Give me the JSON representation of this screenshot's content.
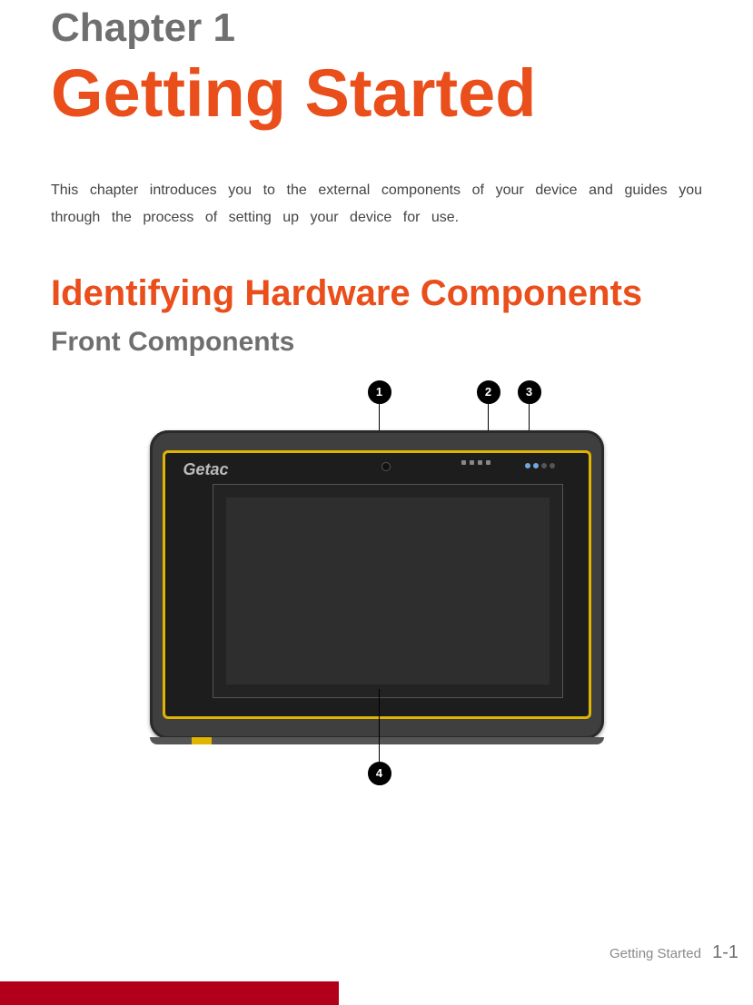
{
  "chapter_label": "Chapter 1",
  "title": "Getting Started",
  "intro": "This chapter introduces you to the external components of your device and guides you through the process of setting up your device for use.",
  "h2": "Identifying Hardware Components",
  "h3": "Front Components",
  "brand": "Getac",
  "callouts": {
    "c1": "1",
    "c2": "2",
    "c3": "3",
    "c4": "4"
  },
  "footer": {
    "section": "Getting Started",
    "page": "1-1"
  }
}
